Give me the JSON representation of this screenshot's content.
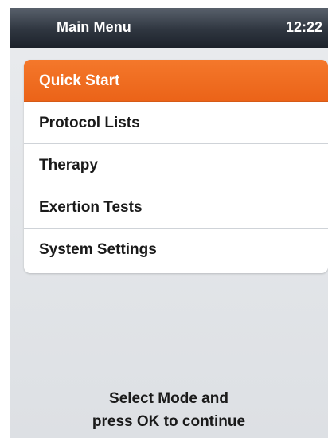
{
  "header": {
    "title": "Main Menu",
    "clock": "12:22"
  },
  "menu": {
    "selected_index": 0,
    "items": [
      {
        "label": "Quick Start"
      },
      {
        "label": "Protocol Lists"
      },
      {
        "label": "Therapy"
      },
      {
        "label": "Exertion Tests"
      },
      {
        "label": "System Settings"
      }
    ]
  },
  "footer": {
    "line1": "Select Mode and",
    "line2": "press OK to continue"
  },
  "colors": {
    "accent": "#ef6b1f",
    "header_bg": "#2f3640",
    "screen_bg": "#e3e6ea"
  }
}
